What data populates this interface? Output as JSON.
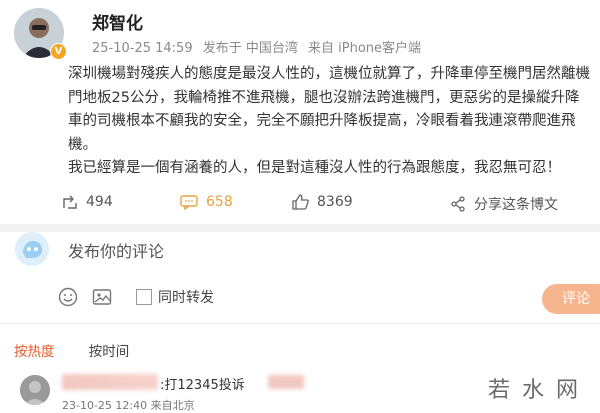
{
  "post": {
    "username": "郑智化",
    "time": "25-10-25 14:59",
    "location": "发布于 中国台湾",
    "source": "来自 iPhone客户端",
    "lines": [
      "深圳機場對殘疾人的態度是最沒人性的，這機位就算了，升降車停至機門居然離機",
      "門地板25公分，我輪椅推不進飛機，腿也沒辦法跨進機門，更惡劣的是操縱升降",
      "車的司機根本不顧我的安全，完全不願把升降板提高，冷眼看着我連滾帶爬進飛",
      "機。",
      "我已經算是一個有涵養的人，但是對這種沒人性的行為跟態度，我忍無可忍！"
    ]
  },
  "actions": {
    "repost_count": "494",
    "comment_count": "658",
    "like_count": "8369",
    "share_label": "分享这条博文"
  },
  "comment_box": {
    "placeholder": "发布你的评论",
    "sync_label": "同时转发",
    "submit_label": "评论"
  },
  "sort": {
    "hot_label": "按热度",
    "time_label": "按时间"
  },
  "comment": {
    "text": ":打12345投诉",
    "meta": "23-10-25 12:40  来自北京"
  },
  "watermark": {
    "text": "若水网"
  },
  "colors": {
    "accent": "#e8a23c",
    "hot_tab": "#e85a2a",
    "submit": "#f6b58c"
  }
}
